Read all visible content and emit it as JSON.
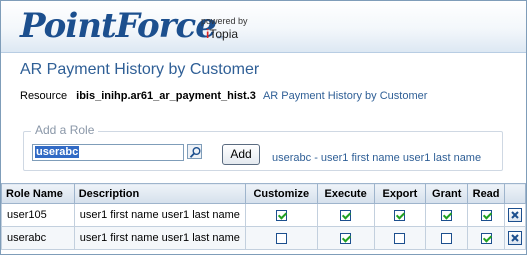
{
  "header": {
    "logo_text": "PointForce",
    "logo_tm": "™",
    "powered_by": "powered by",
    "vendor_i": "i",
    "vendor_rest": "Topia"
  },
  "page": {
    "title": "AR Payment History by Customer",
    "resource_label": "Resource",
    "resource_id": "ibis_inihp.ar61_ar_payment_hist.3",
    "resource_name": "AR Payment History by Customer"
  },
  "add_role": {
    "legend": "Add a Role",
    "input_value": "userabc",
    "add_label": "Add",
    "selected_hint": "userabc - user1 first name user1 last name"
  },
  "table": {
    "headers": [
      "Role Name",
      "Description",
      "Customize",
      "Execute",
      "Export",
      "Grant",
      "Read"
    ],
    "rows": [
      {
        "role": "user105",
        "description": "user1 first name user1 last name",
        "customize": true,
        "execute": true,
        "export": true,
        "grant": true,
        "read": true
      },
      {
        "role": "userabc",
        "description": "user1 first name user1 last name",
        "customize": false,
        "execute": true,
        "export": false,
        "grant": false,
        "read": true
      }
    ]
  },
  "colors": {
    "brand_blue": "#1c4f8e",
    "title_blue": "#2f5f96",
    "check_green": "#21a121",
    "delete_blue": "#1c4f8e"
  },
  "icons": {
    "lookup": "magnifier-icon",
    "delete": "close-x-icon"
  }
}
